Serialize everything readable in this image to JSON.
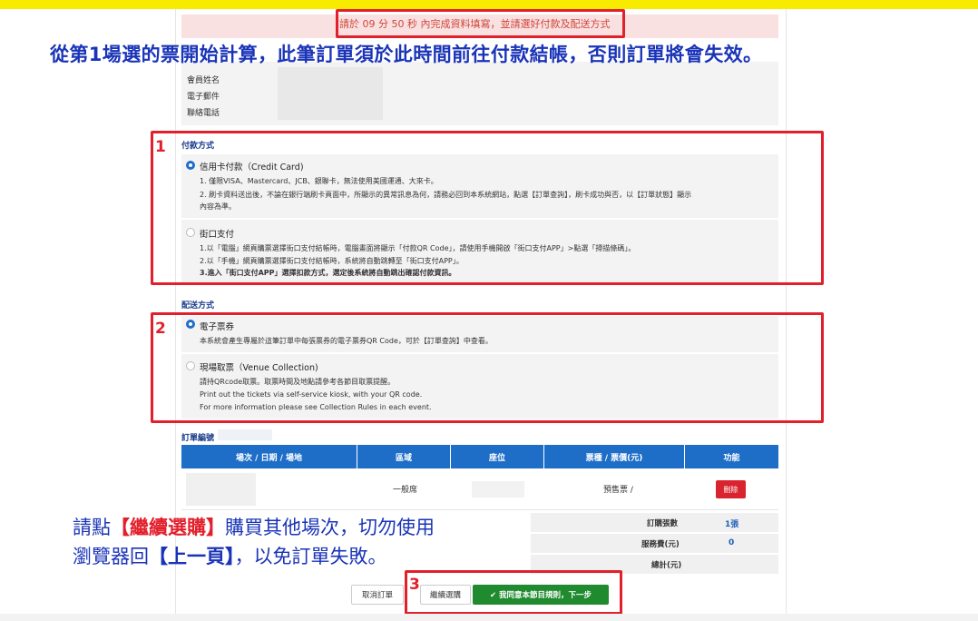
{
  "timer": {
    "text": "請於 09 分 50 秒 內完成資料填寫，並請選好付款及配送方式"
  },
  "notice": {
    "text": "從第1場選的票開始計算，此筆訂單須於此時間前往付款結帳，否則訂單將會失效。"
  },
  "member": {
    "labels": [
      "會員姓名",
      "電子郵件",
      "聯絡電話"
    ]
  },
  "annotations": {
    "n1": "1",
    "n2": "2",
    "n3": "3"
  },
  "payment": {
    "title": "付款方式",
    "options": [
      {
        "label": "信用卡付款（Credit Card)",
        "selected": true,
        "lines": [
          "1. 僅限VISA、Mastercard、JCB、銀聯卡，無法使用美國運通、大來卡。",
          "2. 刷卡資料送出後，不論在銀行端刷卡頁面中，所顯示的異常訊息為何，請務必回到本系統網站，點選【訂單查詢】，刷卡成功與否，以【訂單狀態】顯示",
          "內容為準。"
        ]
      },
      {
        "label": "街口支付",
        "selected": false,
        "lines": [
          "1.以「電腦」網頁購票選擇街口支付結帳時，電腦畫面將顯示「付款QR Code」，請使用手機開啟「街口支付APP」>點選「掃描條碼」。",
          "2.以「手機」網頁購票選擇街口支付結帳時，系統將自動跳轉至「街口支付APP」。",
          "3.進入「街口支付APP」選擇扣款方式，選定後系統將自動跳出確認付款資訊。"
        ]
      }
    ]
  },
  "delivery": {
    "title": "配送方式",
    "options": [
      {
        "label": "電子票券",
        "selected": true,
        "lines": [
          "本系統會產生專屬於這筆訂單中每張票券的電子票券QR Code，可於【訂單查詢】中查看。"
        ]
      },
      {
        "label": "現場取票（Venue Collection)",
        "selected": false,
        "lines": [
          "請持QRcode取票。取票時間及地點請參考各節目取票提醒。",
          "Print out the tickets via self-service kiosk, with your QR code.",
          "For more information please see Collection Rules in each event."
        ]
      }
    ]
  },
  "order": {
    "title": "訂單編號",
    "headers": [
      "場次 / 日期 / 場地",
      "區域",
      "座位",
      "票種 / 票價(元)",
      "功能"
    ],
    "row": {
      "area": "一般席",
      "ticket_type": "預售票 /",
      "delete": "刪除"
    },
    "summary": [
      {
        "label": "訂購張數",
        "value": "1張"
      },
      {
        "label": "服務費(元)",
        "value": "0"
      },
      {
        "label": "總計(元)",
        "value": ""
      }
    ]
  },
  "tip": {
    "line1_pre": "請點",
    "line1_red": "【繼續選購】",
    "line1_post": "購買其他場次，切勿使用",
    "line2_pre": "瀏覽器回",
    "line2_blue": "【上一頁】",
    "line2_post": "，以免訂單失敗。"
  },
  "buttons": {
    "cancel": "取消訂單",
    "continue": "繼續選購",
    "agree": "✔ 我同意本節目規則，下一步"
  },
  "colors": {
    "accent": "#1e6ec8",
    "annotation": "#e2202c",
    "agree": "#1f8a2e",
    "topbar": "#f7ec00"
  }
}
